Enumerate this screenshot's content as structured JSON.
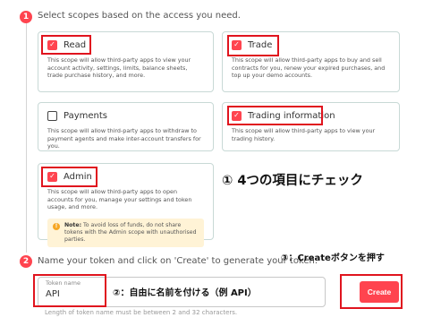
{
  "step1": {
    "number": "1",
    "title": "Select scopes based on the access you need."
  },
  "scopes": [
    {
      "id": "read",
      "label": "Read",
      "checked": true,
      "description": "This scope will allow third-party apps to view your account activity, settings, limits, balance sheets, trade purchase history, and more."
    },
    {
      "id": "trade",
      "label": "Trade",
      "checked": true,
      "description": "This scope will allow third-party apps to buy and sell contracts for you, renew your expired purchases, and top up your demo accounts."
    },
    {
      "id": "payments",
      "label": "Payments",
      "checked": false,
      "description": "This scope will allow third-party apps to withdraw to payment agents and make inter-account transfers for you."
    },
    {
      "id": "trading_information",
      "label": "Trading information",
      "checked": true,
      "description": "This scope will allow third-party apps to view your trading history."
    },
    {
      "id": "admin",
      "label": "Admin",
      "checked": true,
      "description": "This scope will allow third-party apps to open accounts for you, manage your settings and token usage, and more."
    }
  ],
  "note": {
    "icon": "info-icon",
    "bold": "Note:",
    "text": " To avoid loss of funds, do not share tokens with the Admin scope with unauthorised parties."
  },
  "step2": {
    "number": "2",
    "title": "Name your token and click on 'Create' to generate your token."
  },
  "token_input": {
    "label": "Token name",
    "value": "API",
    "hint": "Length of token name must be between 2 and 32 characters."
  },
  "create_button": {
    "label": "Create"
  },
  "annotations": {
    "a1": "① 4つの項目にチェック",
    "a2": "②：自由に名前を付ける（例 API）",
    "a3": "③：Createボタンを押す"
  },
  "colors": {
    "accent": "#ff444f",
    "highlight_box": "#e0141e",
    "card_border": "#c8d9d6",
    "note_bg": "#fff3d6"
  }
}
